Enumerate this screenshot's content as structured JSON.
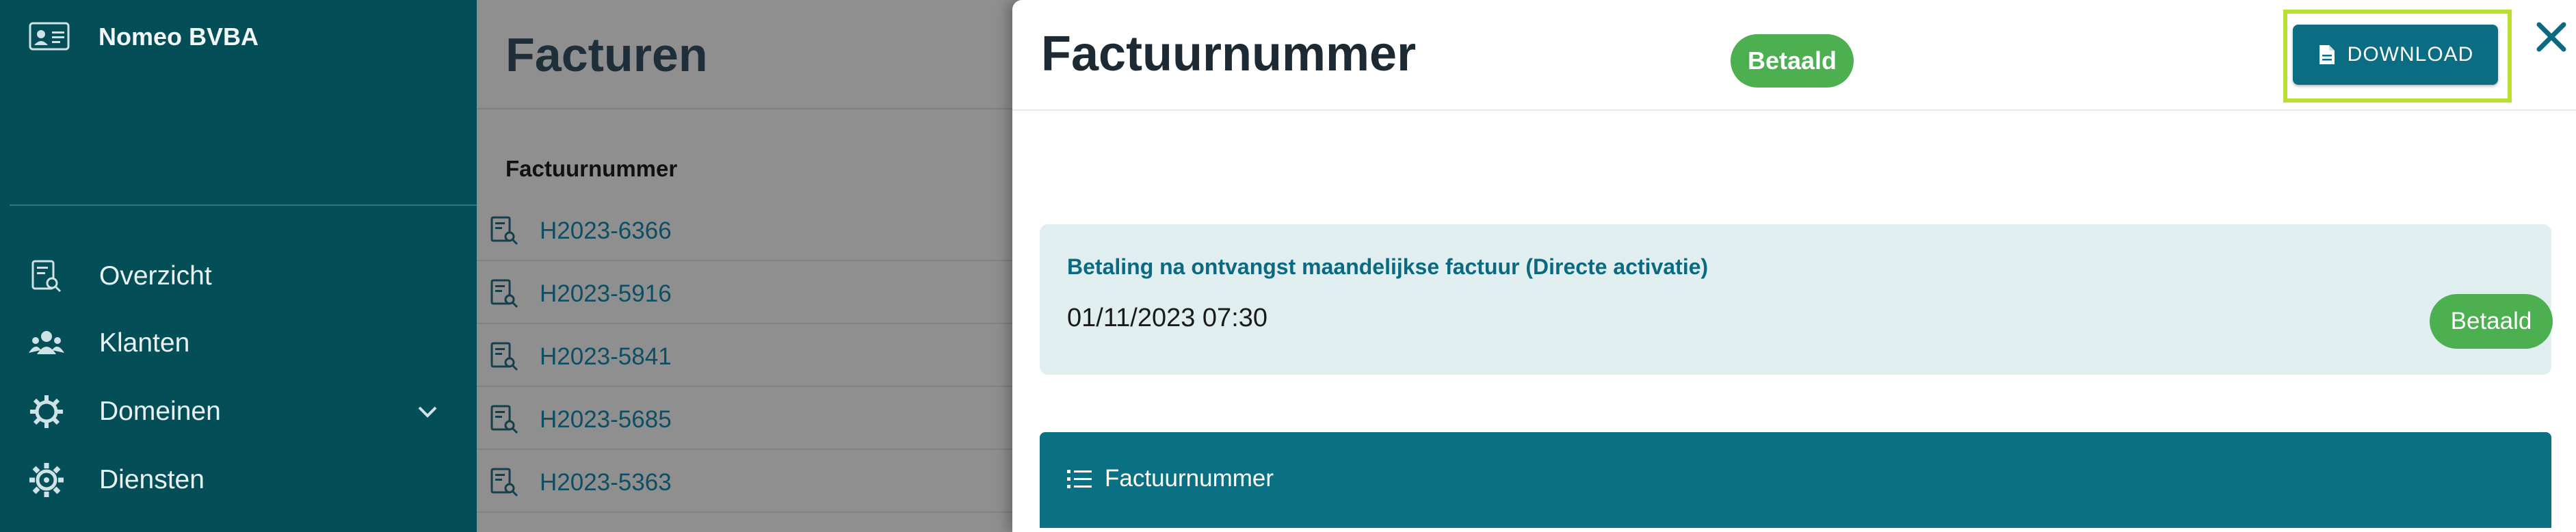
{
  "sidebar": {
    "company_name": "Nomeo BVBA",
    "company_icon": "id-card-icon",
    "items": [
      {
        "label": "Overzicht",
        "icon": "invoice-search-icon"
      },
      {
        "label": "Klanten",
        "icon": "users-icon"
      },
      {
        "label": "Domeinen",
        "icon": "gear-icon",
        "has_chevron": true
      },
      {
        "label": "Diensten",
        "icon": "cog-icon"
      }
    ]
  },
  "main": {
    "title": "Facturen",
    "column_header": "Factuurnummer",
    "rows": [
      {
        "number": "H2023-6366"
      },
      {
        "number": "H2023-5916"
      },
      {
        "number": "H2023-5841"
      },
      {
        "number": "H2023-5685"
      },
      {
        "number": "H2023-5363"
      }
    ]
  },
  "drawer": {
    "title": "Factuurnummer",
    "status_badge": "Betaald",
    "download_label": "DOWNLOAD",
    "close_icon": "close-icon",
    "payment": {
      "title": "Betaling na ontvangst maandelijkse factuur (Directe activatie)",
      "datetime": "01/11/2023 07:30",
      "status": "Betaald"
    },
    "section_label": "Factuurnummer"
  },
  "colors": {
    "sidebar_bg": "#044e58",
    "accent": "#0a7083",
    "success": "#4caf50",
    "highlight": "#b7e02f"
  }
}
